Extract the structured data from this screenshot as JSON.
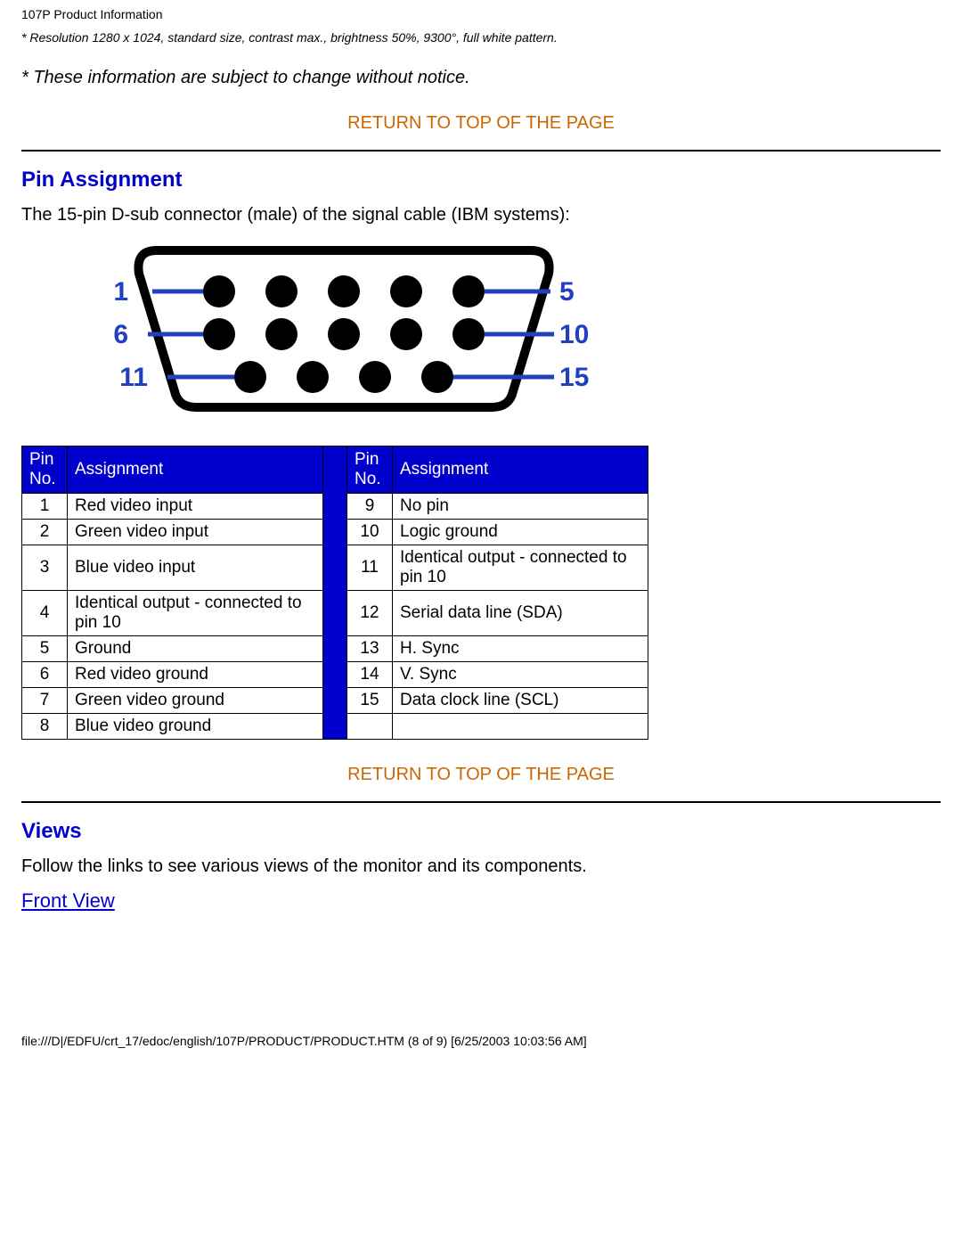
{
  "header": "107P Product Information",
  "res_note": "* Resolution 1280 x 1024, standard size, contrast max., brightness 50%, 9300°, full white pattern.",
  "notice": "* These information are subject to change without notice.",
  "return_top": "RETURN TO TOP OF THE PAGE",
  "pin_section_title": "Pin Assignment",
  "pin_intro": "The 15-pin D-sub connector (male) of the signal cable (IBM systems):",
  "connector_labels": {
    "l1": "1",
    "l2": "6",
    "l3": "11",
    "r1": "5",
    "r2": "10",
    "r3": "15"
  },
  "table_headers": {
    "pin_no": "Pin No.",
    "assignment": "Assignment"
  },
  "pins_left": [
    {
      "n": "1",
      "a": "Red video input"
    },
    {
      "n": "2",
      "a": "Green video input"
    },
    {
      "n": "3",
      "a": "Blue video input"
    },
    {
      "n": "4",
      "a": "Identical output - connected to pin 10"
    },
    {
      "n": "5",
      "a": "Ground"
    },
    {
      "n": "6",
      "a": "Red video ground"
    },
    {
      "n": "7",
      "a": "Green video ground"
    },
    {
      "n": "8",
      "a": "Blue video ground"
    }
  ],
  "pins_right": [
    {
      "n": "9",
      "a": "No pin"
    },
    {
      "n": "10",
      "a": "Logic ground"
    },
    {
      "n": "11",
      "a": "Identical output - connected to pin 10"
    },
    {
      "n": "12",
      "a": "Serial data line (SDA)"
    },
    {
      "n": "13",
      "a": "H. Sync"
    },
    {
      "n": "14",
      "a": "V. Sync"
    },
    {
      "n": "15",
      "a": "Data clock line (SCL)"
    },
    {
      "n": "",
      "a": ""
    }
  ],
  "views_title": "Views",
  "views_intro": "Follow the links to see various views of the monitor and its components.",
  "front_view": "Front View",
  "footer": "file:///D|/EDFU/crt_17/edoc/english/107P/PRODUCT/PRODUCT.HTM (8 of 9) [6/25/2003 10:03:56 AM]"
}
